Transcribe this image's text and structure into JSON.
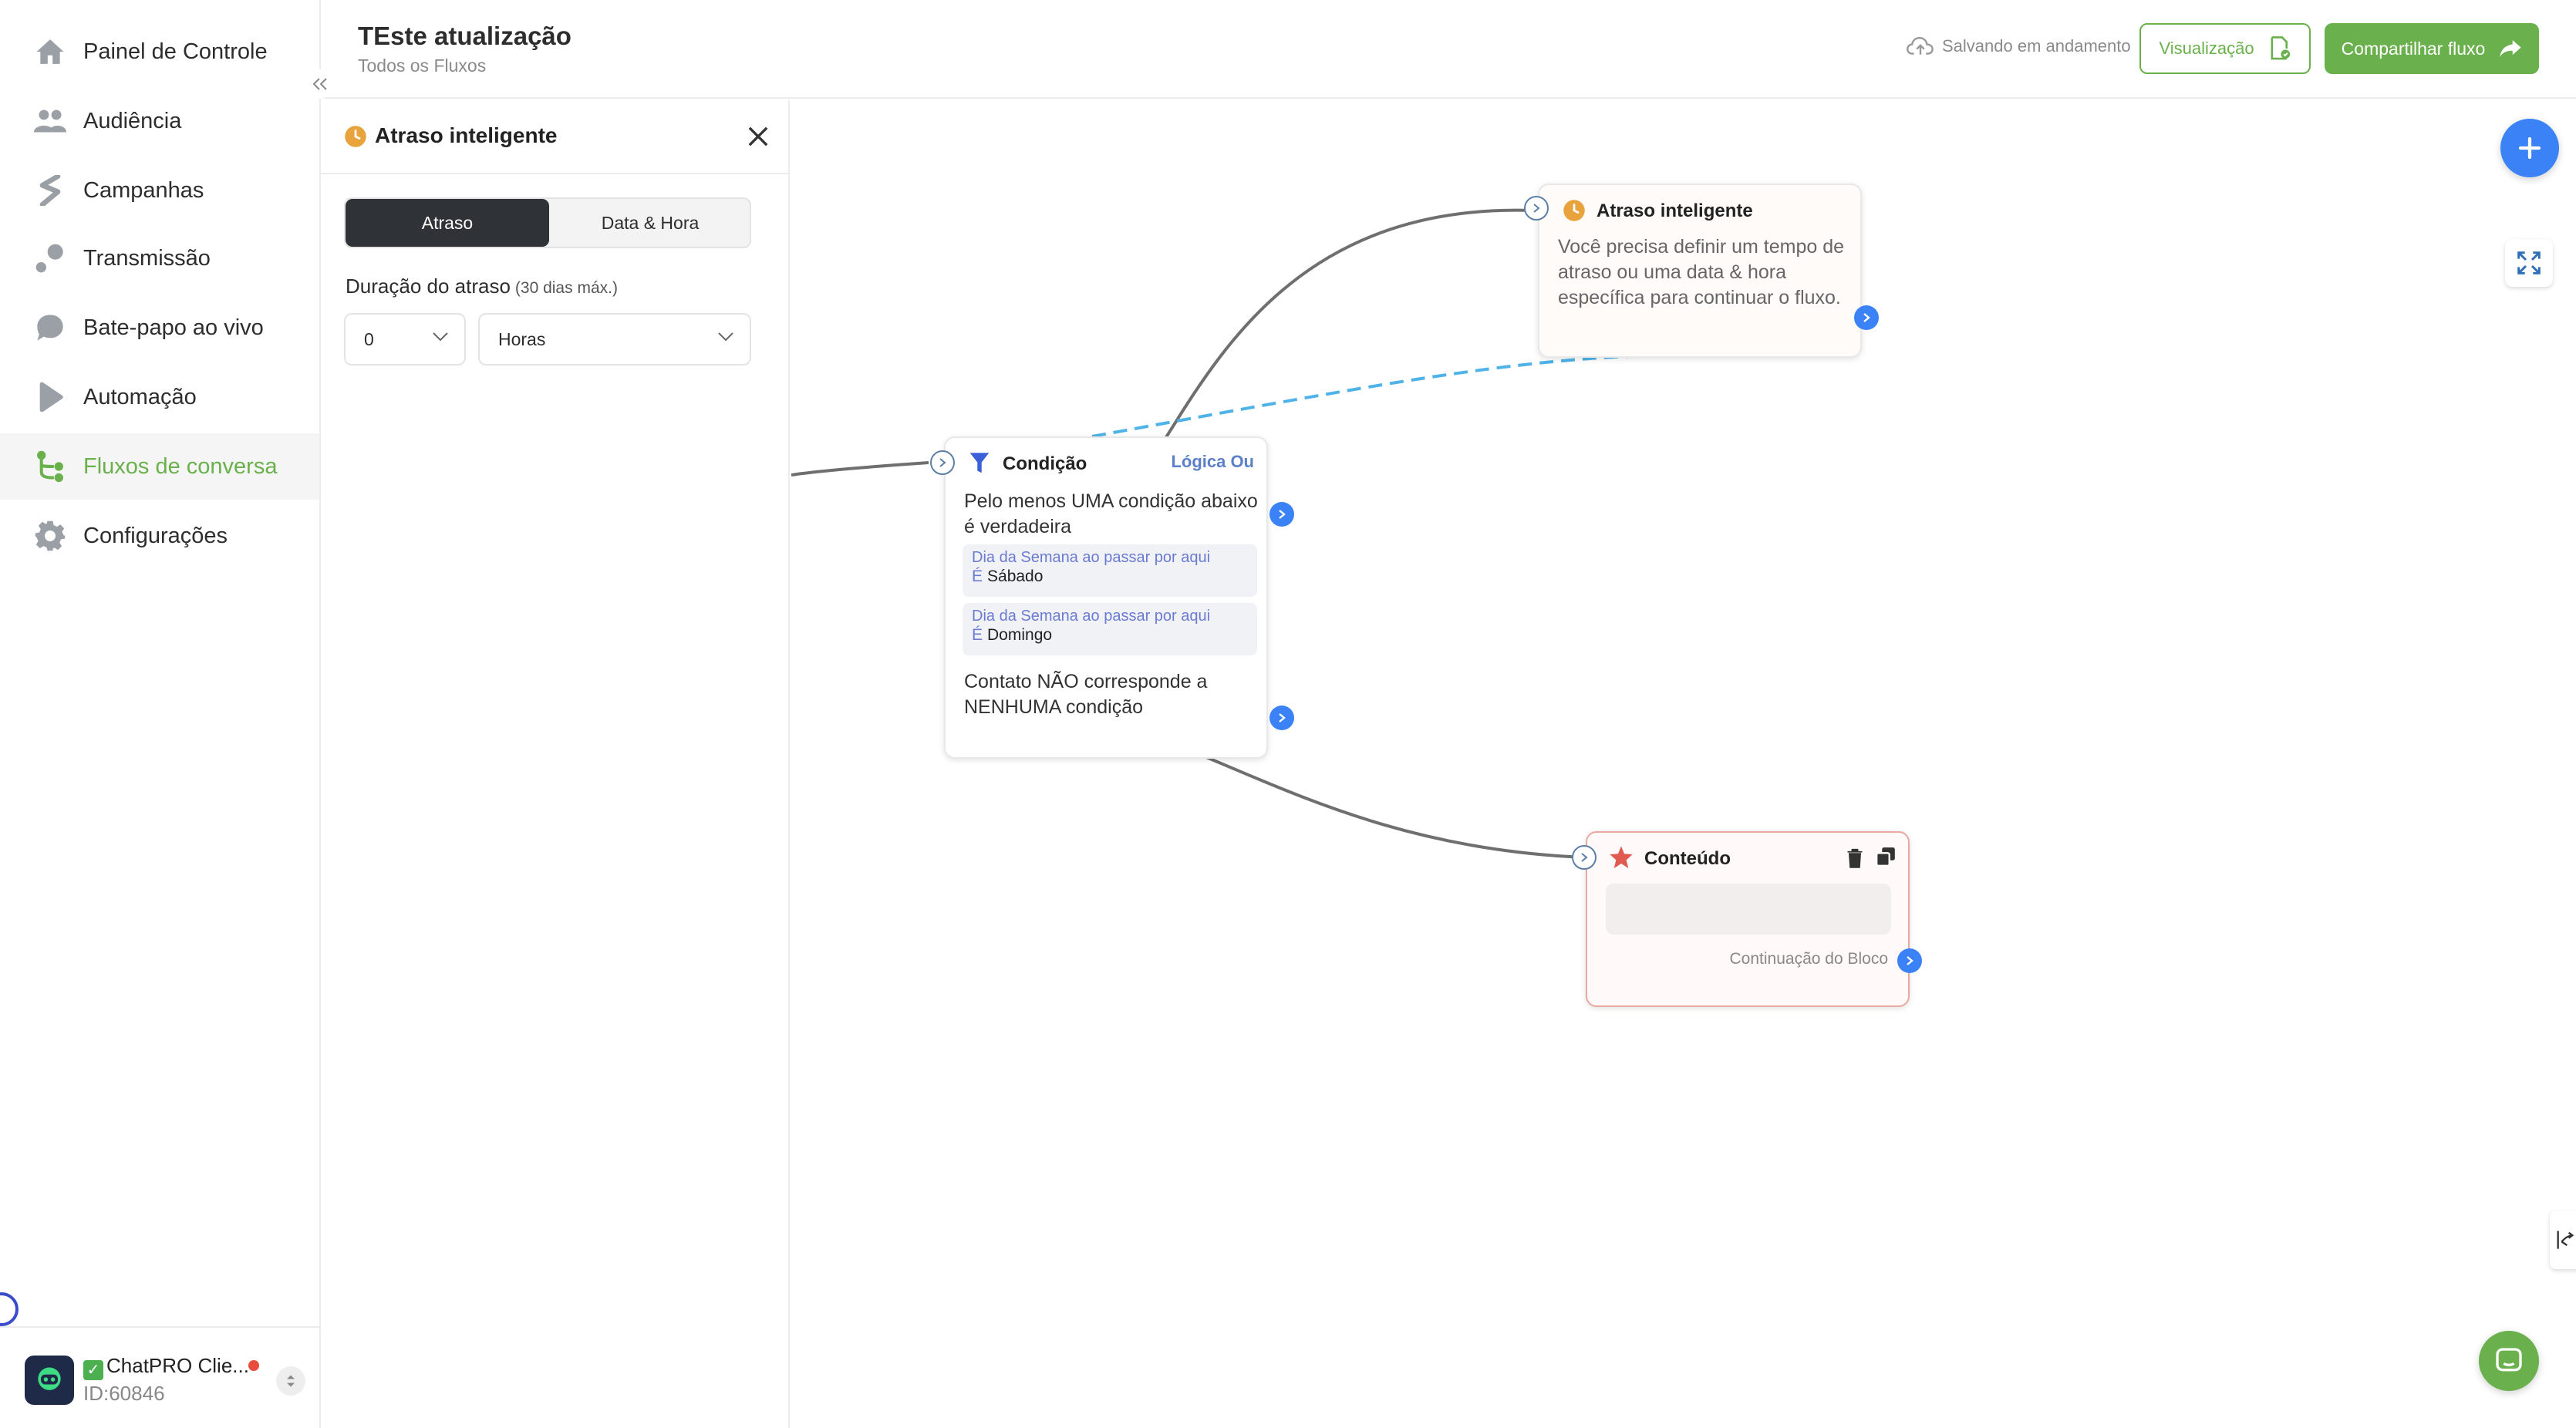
{
  "sidebar": {
    "items": [
      {
        "label": "Painel de Controle",
        "icon": "home-icon"
      },
      {
        "label": "Audiência",
        "icon": "users-icon"
      },
      {
        "label": "Campanhas",
        "icon": "campaign-icon"
      },
      {
        "label": "Transmissão",
        "icon": "broadcast-icon"
      },
      {
        "label": "Bate-papo ao vivo",
        "icon": "chat-bubble-icon"
      },
      {
        "label": "Automação",
        "icon": "play-icon"
      },
      {
        "label": "Fluxos de conversa",
        "icon": "flow-icon",
        "active": true
      },
      {
        "label": "Configurações",
        "icon": "gear-icon"
      }
    ],
    "account": {
      "name": "ChatPRO Clie...",
      "id": "ID:60846",
      "status_color": "#e74c3c"
    }
  },
  "header": {
    "title": "TEste atualização",
    "subtitle": "Todos os Fluxos",
    "saving": "Salvando em andamento",
    "preview_label": "Visualização",
    "share_label": "Compartilhar fluxo"
  },
  "panel": {
    "title": "Atraso inteligente",
    "tabs": [
      "Atraso",
      "Data & Hora"
    ],
    "active_tab": "Atraso",
    "duration_label": "Duração do atraso",
    "duration_hint": "(30 dias máx.)",
    "duration_value": "0",
    "unit_value": "Horas"
  },
  "canvas": {
    "smart_delay": {
      "title": "Atraso inteligente",
      "text": "Você precisa definir um tempo de atraso ou uma data & hora específica para continuar o fluxo."
    },
    "condition": {
      "title": "Condição",
      "logic": "Lógica Ou",
      "any_true": "Pelo menos UMA condição abaixo é verdadeira",
      "conditions": [
        {
          "field": "Dia da Semana ao passar por aqui",
          "op": "É",
          "value": "Sábado"
        },
        {
          "field": "Dia da Semana ao passar por aqui",
          "op": "É",
          "value": "Domingo"
        }
      ],
      "none_match": "Contato NÃO corresponde a NENHUMA condição"
    },
    "content": {
      "title": "Conteúdo",
      "continuation": "Continuação do Bloco"
    }
  },
  "colors": {
    "accent": "#6ab04c",
    "port": "#3b82f6",
    "clock": "#e8a33d",
    "star": "#e05a4f"
  }
}
